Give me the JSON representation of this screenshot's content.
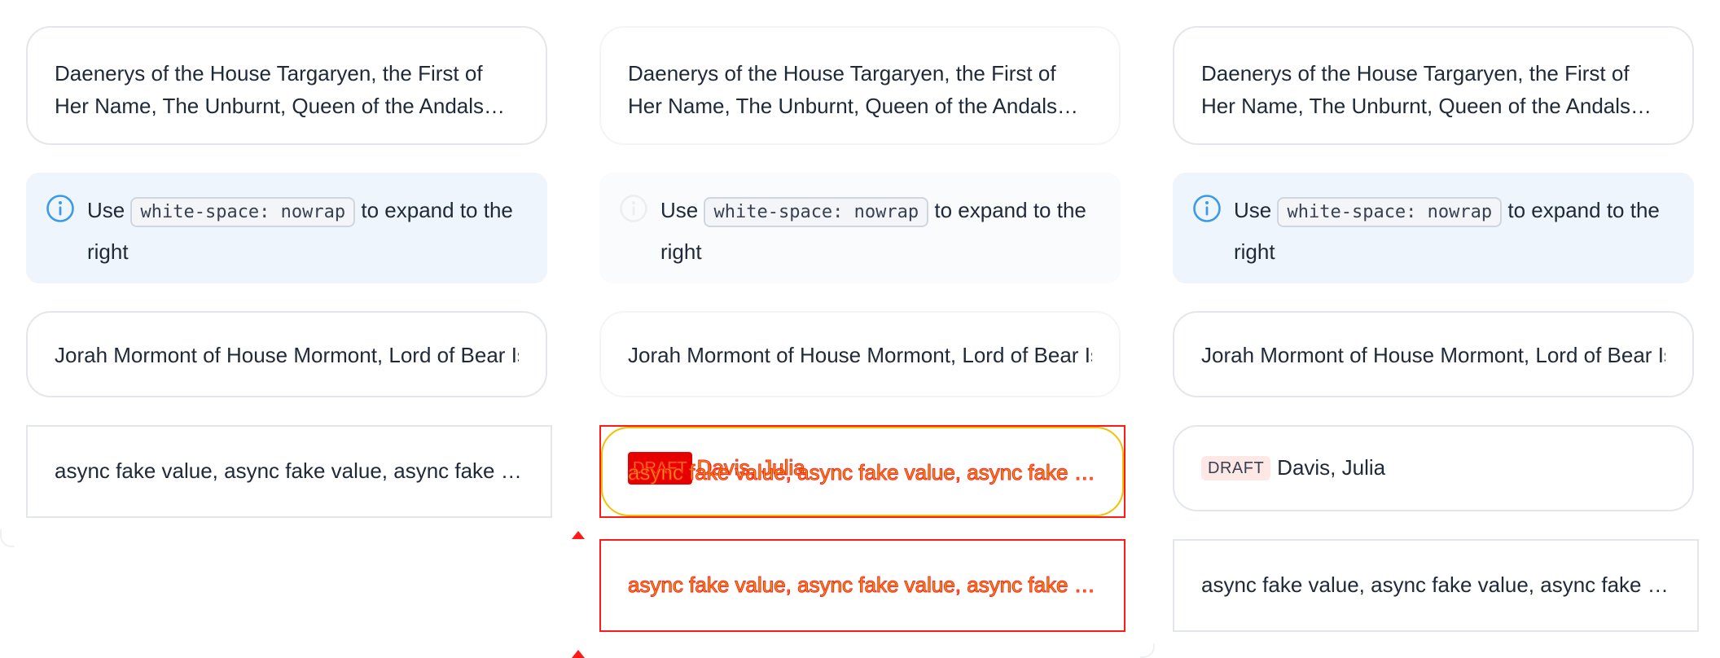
{
  "cards": {
    "long_title": "Daenerys of the House Targaryen, the First of Her Name, The Unburnt, Queen of the Andals and the First Men, Khaleesi of the Great Grass Sea, Breaker of Chains, and Mother of Dragons",
    "info": {
      "use": "Use",
      "code": "white-space: nowrap",
      "rest": "to expand to the right"
    },
    "nowrap_title": "Jorah Mormont of House Mormont, Lord of Bear Island, Knight of the Realm",
    "async_values": "async fake value, async fake value, async fake value, async fake value",
    "badge": "DRAFT",
    "person": "Davis, Julia"
  },
  "colors": {
    "border": "#e5e7eb",
    "info_bg": "#eef5fc",
    "info_icon": "#3b9be8",
    "badge_bg": "#fde8e6",
    "error_outline": "#ff1a1a",
    "warn_outline": "#f2c200"
  },
  "icons": {
    "info": "info-circle-icon"
  }
}
